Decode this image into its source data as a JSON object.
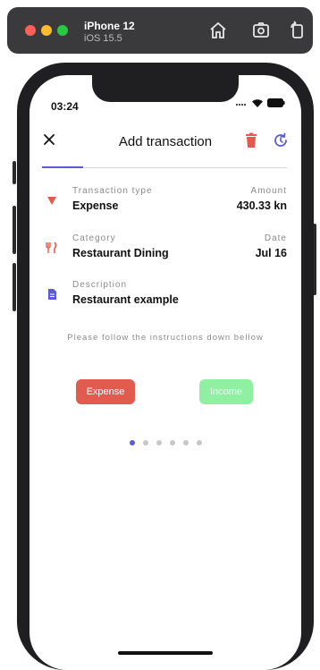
{
  "simulator": {
    "device_name": "iPhone 12",
    "os_version": "iOS 15.5"
  },
  "status_bar": {
    "time": "03:24"
  },
  "header": {
    "title": "Add transaction",
    "delete_icon": "trash-icon",
    "refresh_icon": "refresh-icon",
    "close_icon": "close-icon"
  },
  "colors": {
    "accent": "#5b5bd6",
    "expense": "#e15b4f",
    "income": "#8ff0a2"
  },
  "fields": {
    "transaction_type": {
      "label": "Transaction type",
      "value": "Expense"
    },
    "amount": {
      "label": "Amount",
      "value": "430.33 kn"
    },
    "category": {
      "label": "Category",
      "value": "Restaurant Dining"
    },
    "date": {
      "label": "Date",
      "value": "Jul 16"
    },
    "description": {
      "label": "Description",
      "value": "Restaurant example"
    }
  },
  "instructions": "Please follow the instructions down bellow",
  "buttons": {
    "expense": "Expense",
    "income": "Income"
  },
  "pager": {
    "total": 6,
    "active_index": 0
  }
}
